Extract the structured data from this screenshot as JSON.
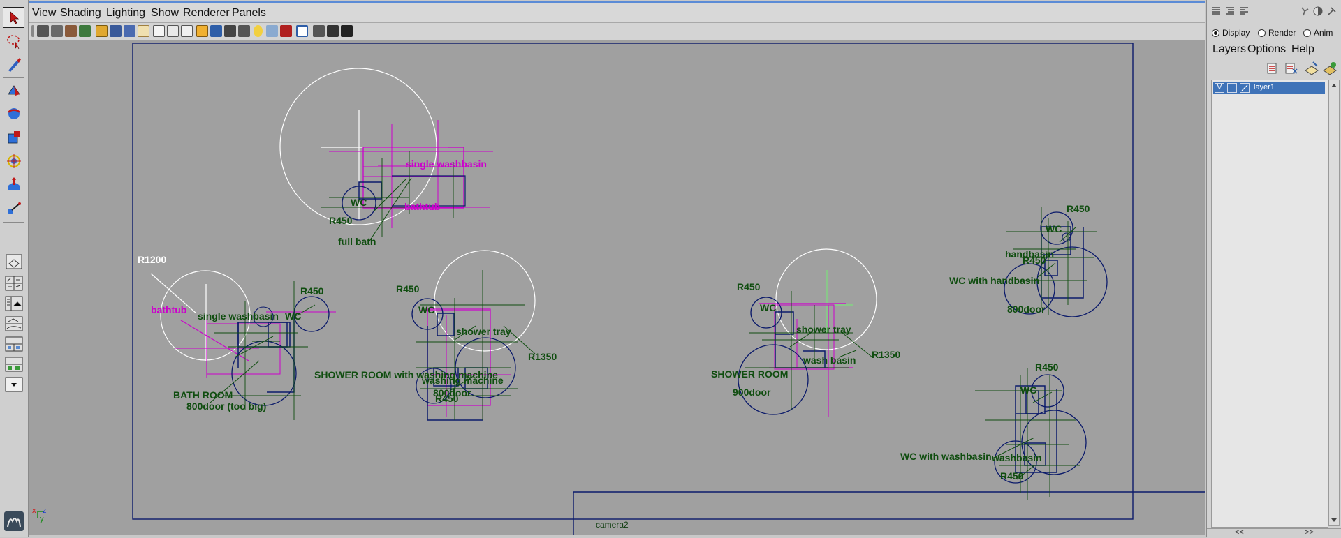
{
  "menubar": {
    "items": [
      "View",
      "Shading",
      "Lighting",
      "Show",
      "Renderer",
      "Panels"
    ]
  },
  "viewport": {
    "camera_label": "camera2",
    "axis_labels": {
      "x": "x",
      "z": "z",
      "y": "y"
    },
    "labels": {
      "full_bath": "full bath",
      "r450_a": "R450",
      "wc_a": "WC",
      "single_washbasin_a": "single washbasin",
      "bathtub_a": "bathtub",
      "r1200": "R1200",
      "bathtub_b": "bathtub",
      "single_washbasin_b": "single washbasin",
      "wc_b": "WC",
      "r450_b": "R450",
      "bath_room": "BATH ROOM",
      "door_800_too_big": "800door (too big)",
      "r450_c": "R450",
      "wc_c": "WC",
      "shower_tray_a": "shower tray",
      "r1350_a": "R1350",
      "shower_room_wm": "SHOWER ROOM with washing machine",
      "washing_machine": "washing machine",
      "door_800_a": "800door",
      "r450_d": "R450",
      "r450_e": "R450",
      "wc_d": "WC",
      "shower_tray_b": "shower tray",
      "r1350_b": "R1350",
      "shower_room": "SHOWER ROOM",
      "wash_basin": "wash basin",
      "door_900": "900door",
      "r450_f": "R450",
      "wc_e": "WC",
      "handbasin": "handbasin",
      "r450_g": "R450",
      "wc_with_handbasin": "WC with handbasin",
      "door_800_b": "800door",
      "r450_h": "R450",
      "wc_f": "WC",
      "wc_with_washbasin": "WC with washbasin",
      "washbasin": "washbasin",
      "r450_i": "R450"
    }
  },
  "rightpanel": {
    "radios": {
      "display": "Display",
      "render": "Render",
      "anim": "Anim"
    },
    "menu": {
      "layers": "Layers",
      "options": "Options",
      "help": "Help"
    },
    "layer": {
      "visible": "V",
      "name": "layer1"
    },
    "scroll": {
      "left": "<<",
      "right": ">>"
    }
  }
}
